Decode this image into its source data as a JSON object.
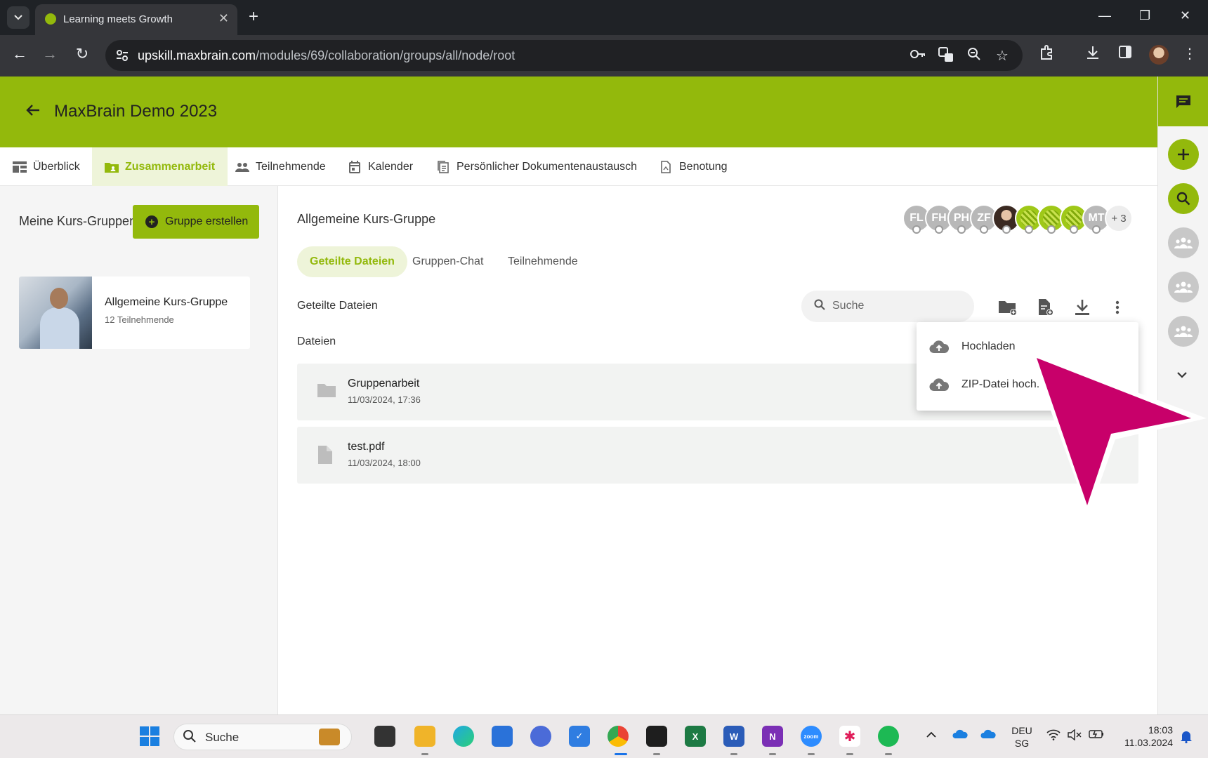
{
  "browser": {
    "tab_title": "Learning meets Growth",
    "url_host": "upskill.maxbrain.com",
    "url_path": "/modules/69/collaboration/groups/all/node/root"
  },
  "app": {
    "title": "MaxBrain Demo 2023",
    "accent_color": "#93b90c"
  },
  "nav_tabs": [
    {
      "label": "Überblick",
      "icon": "dashboard-icon"
    },
    {
      "label": "Zusammenarbeit",
      "icon": "folder-shared-icon",
      "active": true
    },
    {
      "label": "Teilnehmende",
      "icon": "people-icon"
    },
    {
      "label": "Kalender",
      "icon": "calendar-icon"
    },
    {
      "label": "Persönlicher Dokumentenaustausch",
      "icon": "documents-icon"
    },
    {
      "label": "Benotung",
      "icon": "grading-icon"
    }
  ],
  "left_panel": {
    "heading": "Meine Kurs-Gruppen",
    "create_button": "Gruppe erstellen",
    "groups": [
      {
        "name": "Allgemeine Kurs-Gruppe",
        "members": "12 Teilnehmende"
      }
    ]
  },
  "main": {
    "group_title": "Allgemeine Kurs-Gruppe",
    "avatars": [
      "FL",
      "FH",
      "PH",
      "ZF",
      "",
      "",
      "",
      "",
      "MT"
    ],
    "avatar_more": "+ 3",
    "sub_tabs": [
      {
        "label": "Geteilte Dateien",
        "active": true
      },
      {
        "label": "Gruppen-Chat"
      },
      {
        "label": "Teilnehmende"
      }
    ],
    "section_label": "Geteilte Dateien",
    "search_placeholder": "Suche",
    "files_label": "Dateien",
    "files": [
      {
        "name": "Gruppenarbeit",
        "date": "11/03/2024, 17:36",
        "type": "folder"
      },
      {
        "name": "test.pdf",
        "date": "11/03/2024, 18:00",
        "type": "file"
      }
    ]
  },
  "menu": {
    "items": [
      {
        "label": "Hochladen",
        "icon": "cloud-upload-icon"
      },
      {
        "label": "ZIP-Datei hoch.",
        "icon": "cloud-upload-icon"
      }
    ]
  },
  "taskbar": {
    "search_label": "Suche",
    "lang_top": "DEU",
    "lang_bottom": "SG",
    "time": "18:03",
    "date": "11.03.2024"
  },
  "pointer_color": "#c8006a"
}
